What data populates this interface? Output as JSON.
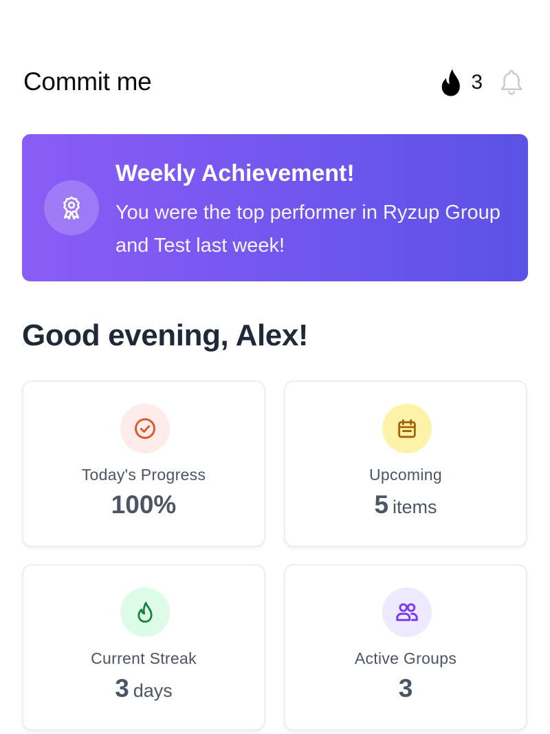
{
  "header": {
    "title": "Commit me",
    "streak_count": "3",
    "icons": {
      "streak": "flame-icon",
      "notifications": "bell-icon"
    }
  },
  "banner": {
    "title": "Weekly Achievement!",
    "message": "You were the top performer in Ryzup Group and Test last week!",
    "icon": "award-ribbon-icon",
    "colors": {
      "gradient_start": "#8b5cf6",
      "gradient_end": "#5b52e6"
    }
  },
  "greeting": "Good evening, Alex!",
  "stats": [
    {
      "label": "Today's Progress",
      "value": "100%",
      "unit": "",
      "icon": "check-circle-icon",
      "icon_color": "#dc5a2c",
      "icon_bg": "#fdecea"
    },
    {
      "label": "Upcoming",
      "value": "5",
      "unit": "items",
      "icon": "calendar-icon",
      "icon_color": "#a16207",
      "icon_bg": "#fdf3a8"
    },
    {
      "label": "Current Streak",
      "value": "3",
      "unit": "days",
      "icon": "flame-icon",
      "icon_color": "#15803d",
      "icon_bg": "#dcfce7"
    },
    {
      "label": "Active Groups",
      "value": "3",
      "unit": "",
      "icon": "users-icon",
      "icon_color": "#7e3af2",
      "icon_bg": "#ede9fe"
    }
  ]
}
